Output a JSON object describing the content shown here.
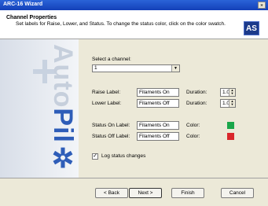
{
  "window": {
    "title": "ARC-16 Wizard",
    "close_glyph": "×"
  },
  "header": {
    "title": "Channel Properties",
    "subtitle": "Set labels for Raise, Lower, and Status. To change the status color, click on the color swatch.",
    "logo_text": "AS"
  },
  "sidebar": {
    "brand_part1": "Auto",
    "brand_part2": "Pil",
    "brand_part3": "✲"
  },
  "channel": {
    "label": "Select a channel:",
    "selected": "1",
    "arrow": "▼"
  },
  "raise": {
    "label": "Raise Label:",
    "value": "Filaments On",
    "duration_label": "Duration:",
    "duration": "1.0"
  },
  "lower": {
    "label": "Lower Label:",
    "value": "Filaments Off",
    "duration_label": "Duration:",
    "duration": "1.0"
  },
  "status_on": {
    "label": "Status On Label:",
    "value": "Filaments On",
    "color_label": "Color:",
    "color": "#1aa64a"
  },
  "status_off": {
    "label": "Status Off Label:",
    "value": "Filaments Off",
    "color_label": "Color:",
    "color": "#d9262b"
  },
  "log_status": {
    "label": "Log status changes",
    "checked": true,
    "check_glyph": "✓"
  },
  "buttons": {
    "back": "< Back",
    "next": "Next >",
    "finish": "Finish",
    "cancel": "Cancel"
  },
  "icons": {
    "spin_up": "▲",
    "spin_down": "▼"
  }
}
